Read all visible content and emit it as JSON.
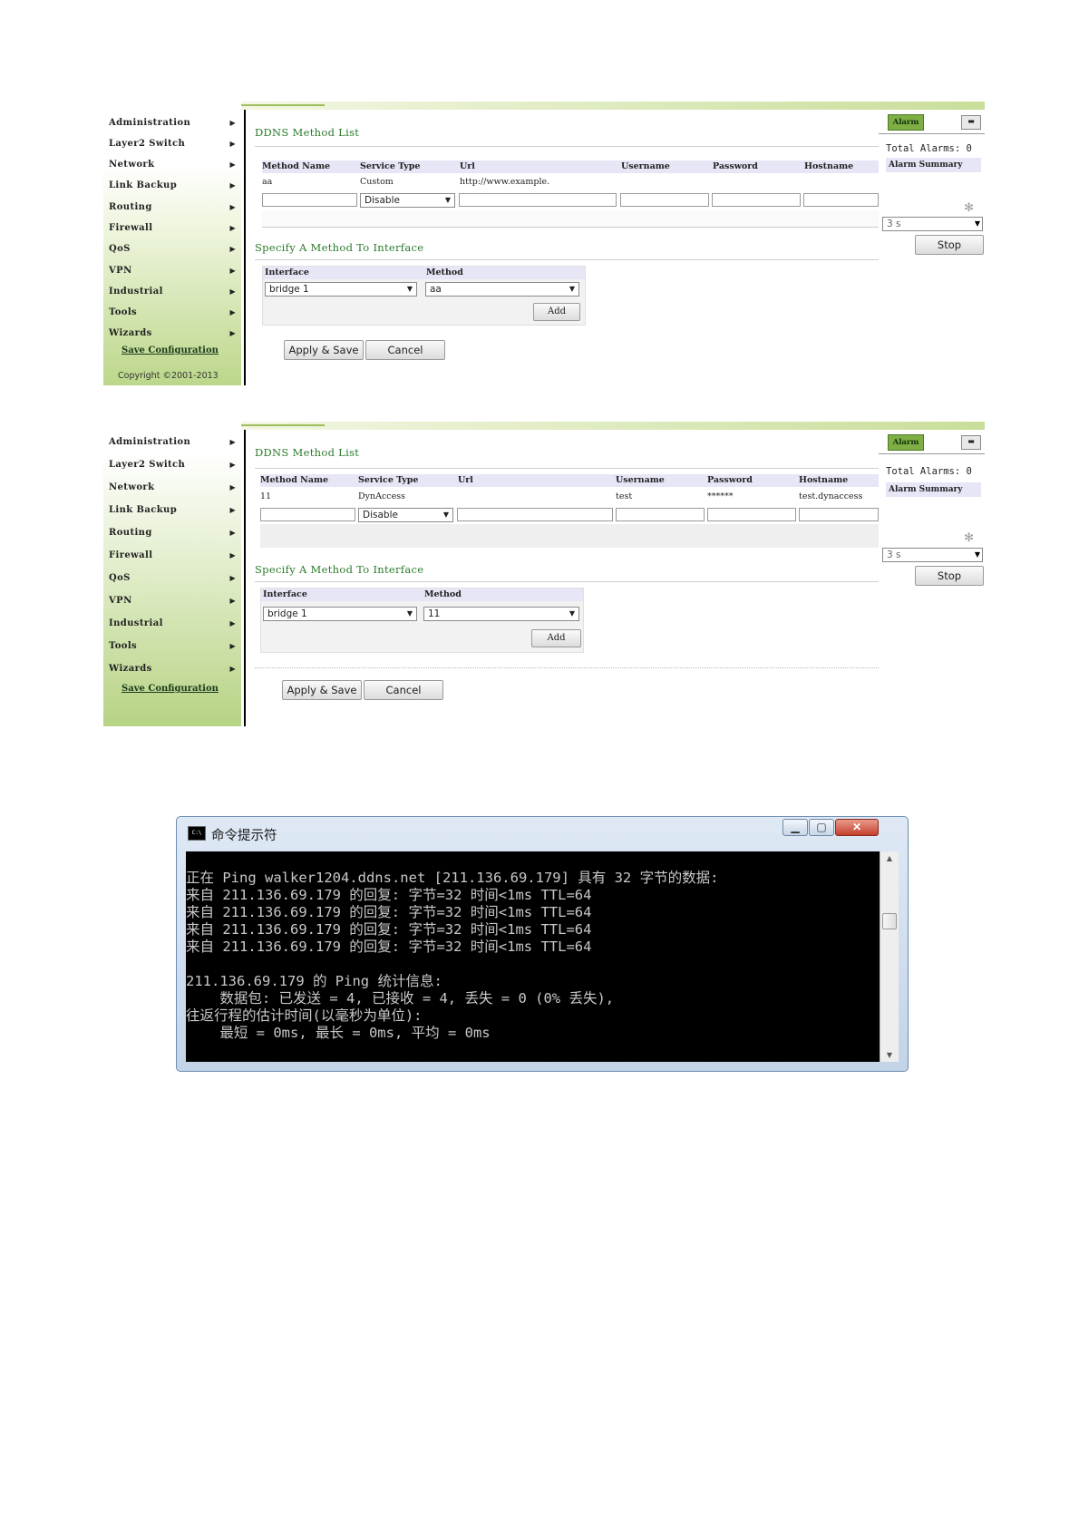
{
  "sidebar": {
    "items": [
      "Administration",
      "Layer2 Switch",
      "Network",
      "Link Backup",
      "Routing",
      "Firewall",
      "QoS",
      "VPN",
      "Industrial",
      "Tools",
      "Wizards"
    ],
    "save_config": "Save Configuration",
    "copyright": "Copyright ©2001-2013"
  },
  "ddns": {
    "list_title": "DDNS Method List",
    "columns": [
      "Method Name",
      "Service Type",
      "Url",
      "Username",
      "Password",
      "Hostname"
    ],
    "specify_title": "Specify A Method To Interface",
    "iface_columns": [
      "Interface",
      "Method"
    ],
    "add_label": "Add",
    "apply_label": "Apply & Save",
    "cancel_label": "Cancel"
  },
  "panel1": {
    "row": {
      "method_name": "aa",
      "service_type": "Custom",
      "url": "http://www.example.",
      "username": "",
      "password": "",
      "hostname": ""
    },
    "new_service_select": "Disable",
    "interface_select": "bridge 1",
    "method_select": "aa"
  },
  "panel2": {
    "row": {
      "method_name": "11",
      "service_type": "DynAccess",
      "url": "",
      "username": "test",
      "password": "******",
      "hostname": "test.dynaccess"
    },
    "new_service_select": "Disable",
    "interface_select": "bridge 1",
    "method_select": "11"
  },
  "alarm": {
    "tab_label": "Alarm",
    "total_label": "Total Alarms: 0",
    "summary_label": "Alarm Summary",
    "interval_select": "3 s",
    "stop_label": "Stop"
  },
  "cmd": {
    "title": "命令提示符",
    "icon_text": "C:\\",
    "lines": [
      "正在 Ping walker1204.ddns.net [211.136.69.179] 具有 32 字节的数据:",
      "来自 211.136.69.179 的回复: 字节=32 时间<1ms TTL=64",
      "来自 211.136.69.179 的回复: 字节=32 时间<1ms TTL=64",
      "来自 211.136.69.179 的回复: 字节=32 时间<1ms TTL=64",
      "来自 211.136.69.179 的回复: 字节=32 时间<1ms TTL=64",
      "",
      "211.136.69.179 的 Ping 统计信息:",
      "    数据包: 已发送 = 4, 已接收 = 4, 丢失 = 0 (0% 丢失),",
      "往返行程的估计时间(以毫秒为单位):",
      "    最短 = 0ms, 最长 = 0ms, 平均 = 0ms"
    ]
  }
}
